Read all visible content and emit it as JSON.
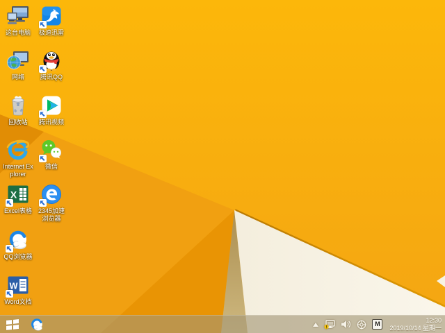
{
  "desktop": {
    "icons": [
      {
        "name": "this-pc",
        "label": "这台电脑",
        "shortcut": false
      },
      {
        "name": "thunder-speed",
        "label": "极速迅雷",
        "shortcut": true
      },
      {
        "name": "network",
        "label": "网络",
        "shortcut": false
      },
      {
        "name": "tencent-qq",
        "label": "腾讯QQ",
        "shortcut": true
      },
      {
        "name": "recycle-bin",
        "label": "回收站",
        "shortcut": false
      },
      {
        "name": "tencent-video",
        "label": "腾讯视频",
        "shortcut": true
      },
      {
        "name": "internet-explorer",
        "label": "Internet Explorer",
        "shortcut": false
      },
      {
        "name": "wechat",
        "label": "微信",
        "shortcut": true
      },
      {
        "name": "excel-sheet",
        "label": "Excel表格",
        "shortcut": true
      },
      {
        "name": "2345-browser",
        "label": "2345加速浏览器",
        "shortcut": true
      },
      {
        "name": "qq-browser",
        "label": "QQ浏览器",
        "shortcut": true
      },
      {
        "name": "word-doc",
        "label": "Word文档",
        "shortcut": true
      }
    ]
  },
  "taskbar": {
    "pinned": [
      {
        "name": "qq-browser"
      }
    ],
    "tray": {
      "hidden_icons_caret": "▲",
      "icons": [
        "network-status",
        "volume",
        "utility-crosshair",
        "input-method"
      ],
      "input_indicator": "M",
      "network_warning": true
    },
    "clock": {
      "time": "12:30",
      "date": "2019/10/14 星期一"
    }
  },
  "wallpaper": {
    "style": "windows-8.1-gold-folds",
    "colors": {
      "base_top": "#FCB70A",
      "base_bottom": "#F4A513",
      "dark_fold": "#E18D05",
      "mid_fold": "#F1A011",
      "lower_fold": "#E99404",
      "tan_shadow": "#C0A96E",
      "cream_wedge": "#F7F2E4",
      "edge_shadow": "#C07E00",
      "taskbar_tint": "#A39676"
    }
  }
}
